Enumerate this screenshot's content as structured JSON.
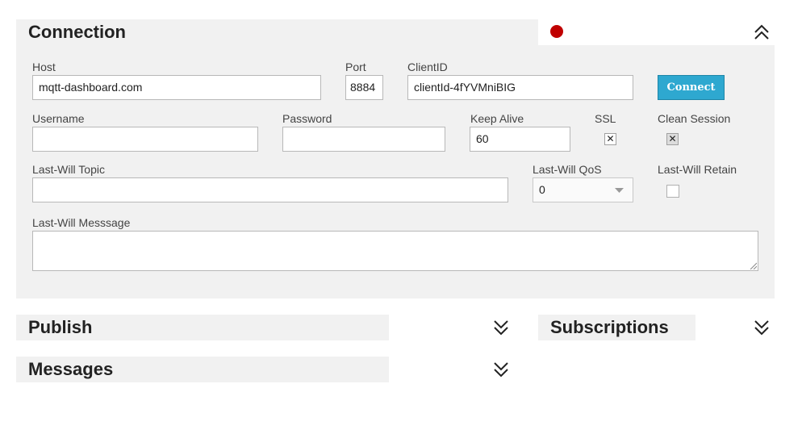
{
  "connection": {
    "title": "Connection",
    "status_color": "#c00000",
    "host_label": "Host",
    "host_value": "mqtt-dashboard.com",
    "port_label": "Port",
    "port_value": "8884",
    "clientid_label": "ClientID",
    "clientid_value": "clientId-4fYVMniBIG",
    "connect_label": "Connect",
    "username_label": "Username",
    "username_value": "",
    "password_label": "Password",
    "password_value": "",
    "keepalive_label": "Keep Alive",
    "keepalive_value": "60",
    "ssl_label": "SSL",
    "ssl_checked": true,
    "ssl_mark": "✕",
    "clean_session_label": "Clean Session",
    "clean_session_checked": true,
    "clean_session_mark": "✕",
    "lastwill_topic_label": "Last-Will Topic",
    "lastwill_topic_value": "",
    "lastwill_qos_label": "Last-Will QoS",
    "lastwill_qos_value": "0",
    "lastwill_retain_label": "Last-Will Retain",
    "lastwill_retain_checked": false,
    "lastwill_message_label": "Last-Will Messsage",
    "lastwill_message_value": "",
    "collapse_icon": "chevron-double-up-icon"
  },
  "publish": {
    "title": "Publish",
    "expand_icon": "chevron-double-down-icon"
  },
  "subscriptions": {
    "title": "Subscriptions",
    "expand_icon": "chevron-double-down-icon"
  },
  "messages": {
    "title": "Messages",
    "expand_icon": "chevron-double-down-icon"
  },
  "colors": {
    "panel_bg": "#f1f1f1",
    "accent": "#2ea8d0",
    "status_disconnected": "#c00000"
  }
}
